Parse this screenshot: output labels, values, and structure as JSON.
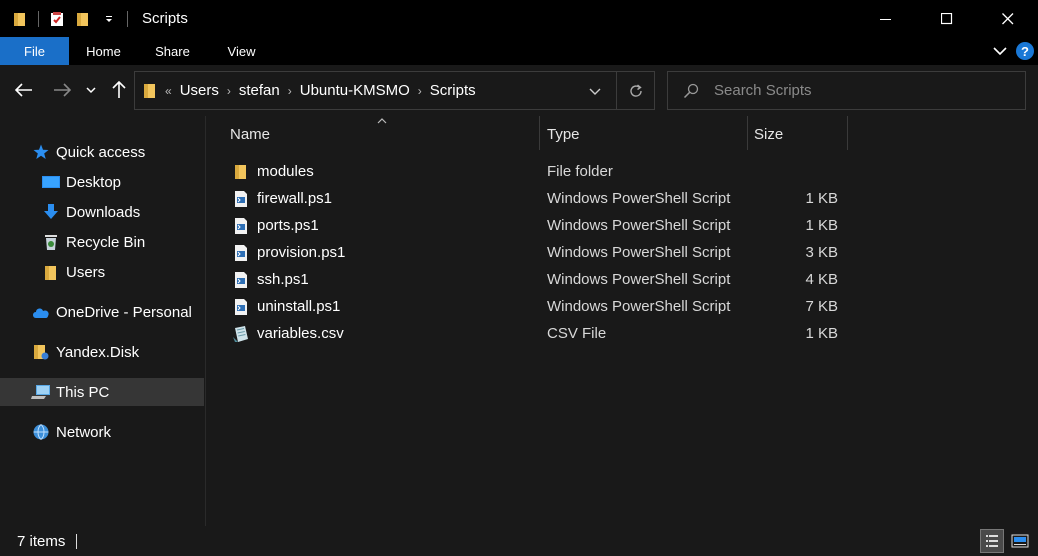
{
  "window": {
    "title": "Scripts"
  },
  "ribbon": {
    "tabs": [
      "File",
      "Home",
      "Share",
      "View"
    ],
    "help_label": "?"
  },
  "address": {
    "overflow_marker": "«",
    "breadcrumbs": [
      "Users",
      "stefan",
      "Ubuntu-KMSMO",
      "Scripts"
    ]
  },
  "search": {
    "placeholder": "Search Scripts"
  },
  "nav": {
    "quick_access": "Quick access",
    "pinned": [
      "Desktop",
      "Downloads",
      "Recycle Bin",
      "Users"
    ],
    "onedrive": "OneDrive - Personal",
    "yandex": "Yandex.Disk",
    "this_pc": "This PC",
    "network": "Network"
  },
  "columns": {
    "name": "Name",
    "type": "Type",
    "size": "Size"
  },
  "files": [
    {
      "name": "modules",
      "type": "File folder",
      "size": "",
      "icon": "folder-icon"
    },
    {
      "name": "firewall.ps1",
      "type": "Windows PowerShell Script",
      "size": "1 KB",
      "icon": "powershell-script-icon"
    },
    {
      "name": "ports.ps1",
      "type": "Windows PowerShell Script",
      "size": "1 KB",
      "icon": "powershell-script-icon"
    },
    {
      "name": "provision.ps1",
      "type": "Windows PowerShell Script",
      "size": "3 KB",
      "icon": "powershell-script-icon"
    },
    {
      "name": "ssh.ps1",
      "type": "Windows PowerShell Script",
      "size": "4 KB",
      "icon": "powershell-script-icon"
    },
    {
      "name": "uninstall.ps1",
      "type": "Windows PowerShell Script",
      "size": "7 KB",
      "icon": "powershell-script-icon"
    },
    {
      "name": "variables.csv",
      "type": "CSV File",
      "size": "1 KB",
      "icon": "csv-file-icon"
    }
  ],
  "status": {
    "item_count": "7 items"
  },
  "colors": {
    "background": "#191919",
    "titlebar": "#000000",
    "file_tab": "#1a6fc8",
    "folder": "#f2c55c",
    "selection": "#363636"
  }
}
